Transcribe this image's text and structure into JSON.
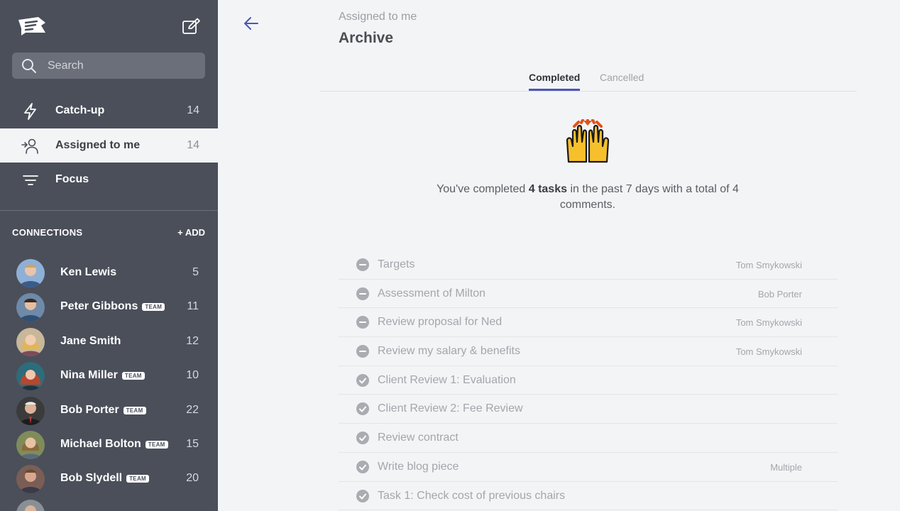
{
  "sidebar": {
    "search_placeholder": "Search",
    "nav": [
      {
        "label": "Catch-up",
        "count": "14",
        "icon": "bolt-icon"
      },
      {
        "label": "Assigned to me",
        "count": "14",
        "icon": "assign-user-icon"
      },
      {
        "label": "Focus",
        "count": "",
        "icon": "filter-lines-icon"
      }
    ],
    "connections_heading": "CONNECTIONS",
    "add_label": "+ ADD",
    "team_badge": "TEAM",
    "contacts": [
      {
        "name": "Ken Lewis",
        "count": "5",
        "team": false
      },
      {
        "name": "Peter Gibbons",
        "count": "11",
        "team": true
      },
      {
        "name": "Jane Smith",
        "count": "12",
        "team": false
      },
      {
        "name": "Nina Miller",
        "count": "10",
        "team": true
      },
      {
        "name": "Bob Porter",
        "count": "22",
        "team": true
      },
      {
        "name": "Michael Bolton",
        "count": "15",
        "team": true
      },
      {
        "name": "Bob Slydell",
        "count": "20",
        "team": true
      }
    ]
  },
  "main": {
    "breadcrumb": "Assigned to me",
    "title": "Archive",
    "tabs": [
      {
        "label": "Completed",
        "active": true
      },
      {
        "label": "Cancelled",
        "active": false
      }
    ],
    "summary": {
      "prefix": "You've completed ",
      "bold": "4 tasks",
      "suffix": " in the past 7 days with a total of 4 comments."
    },
    "tasks": [
      {
        "name": "Targets",
        "owner": "Tom Smykowski",
        "status": "cancelled"
      },
      {
        "name": "Assessment of Milton",
        "owner": "Bob Porter",
        "status": "cancelled"
      },
      {
        "name": "Review proposal for Ned",
        "owner": "Tom Smykowski",
        "status": "cancelled"
      },
      {
        "name": "Review my salary & benefits",
        "owner": "Tom Smykowski",
        "status": "cancelled"
      },
      {
        "name": "Client Review 1: Evaluation",
        "owner": "",
        "status": "completed"
      },
      {
        "name": "Client Review 2: Fee Review",
        "owner": "",
        "status": "completed"
      },
      {
        "name": "Review contract",
        "owner": "",
        "status": "completed"
      },
      {
        "name": "Write blog piece",
        "owner": "Multiple",
        "status": "completed"
      },
      {
        "name": "Task 1: Check cost of previous chairs",
        "owner": "",
        "status": "completed"
      }
    ]
  },
  "colors": {
    "sidebar_bg": "#4a4f5a",
    "page_bg": "#f3f4f6",
    "accent": "#4a57b5"
  }
}
